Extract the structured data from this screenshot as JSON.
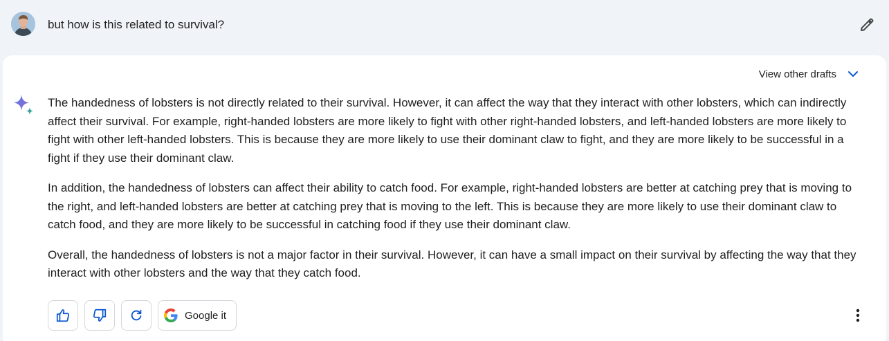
{
  "prompt": {
    "text": "but how is this related to survival?",
    "avatar_icon": "user-avatar",
    "edit_icon": "pencil-icon"
  },
  "response": {
    "view_drafts_label": "View other drafts",
    "paragraphs": [
      "The handedness of lobsters is not directly related to their survival. However, it can affect the way that they interact with other lobsters, which can indirectly affect their survival. For example, right-handed lobsters are more likely to fight with other right-handed lobsters, and left-handed lobsters are more likely to fight with other left-handed lobsters. This is because they are more likely to use their dominant claw to fight, and they are more likely to be successful in a fight if they use their dominant claw.",
      "In addition, the handedness of lobsters can affect their ability to catch food. For example, right-handed lobsters are better at catching prey that is moving to the right, and left-handed lobsters are better at catching prey that is moving to the left. This is because they are more likely to use their dominant claw to catch food, and they are more likely to be successful in catching food if they use their dominant claw.",
      "Overall, the handedness of lobsters is not a major factor in their survival. However, it can have a small impact on their survival by affecting the way that they interact with other lobsters and the way that they catch food."
    ]
  },
  "actions": {
    "thumbs_up_icon": "thumbs-up-icon",
    "thumbs_down_icon": "thumbs-down-icon",
    "regenerate_icon": "refresh-icon",
    "google_it_label": "Google it",
    "more_icon": "more-vert-icon"
  },
  "colors": {
    "background": "#f0f4f9",
    "card": "#ffffff",
    "accent_blue": "#0b57d0",
    "text": "#1f1f1f"
  }
}
